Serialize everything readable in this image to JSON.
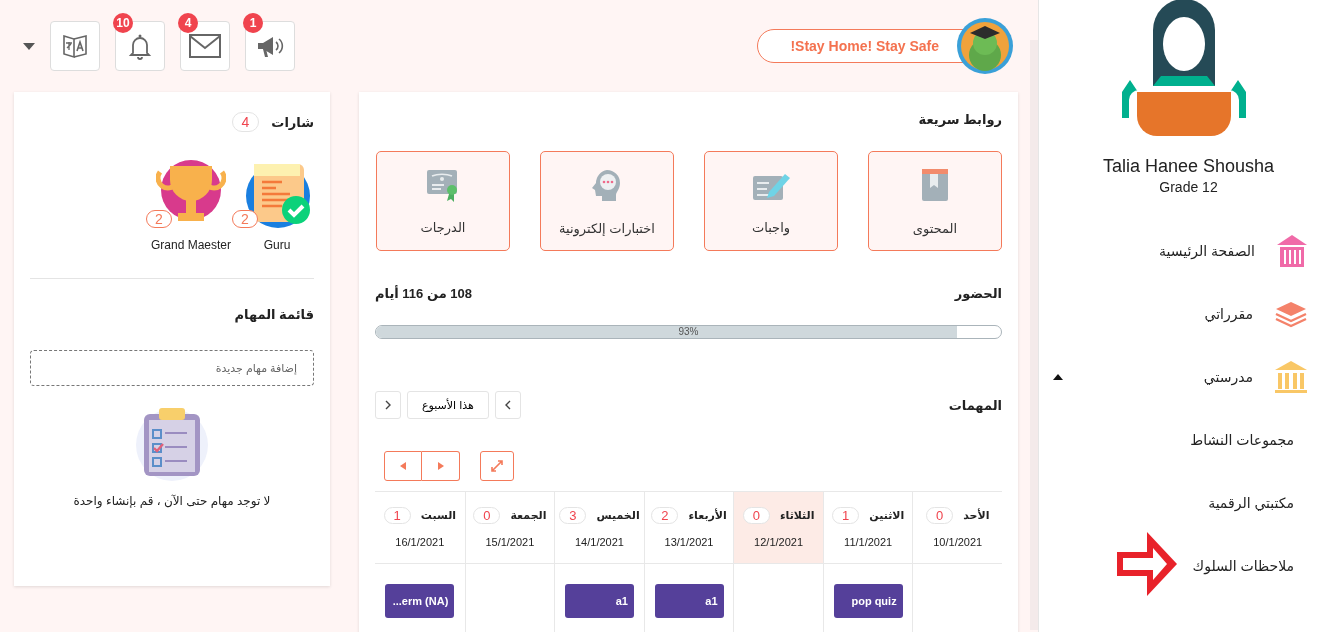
{
  "header": {
    "alerts": [
      {
        "kind": "megaphone",
        "count": "1"
      },
      {
        "kind": "mail",
        "count": "4"
      },
      {
        "kind": "bell",
        "count": "10"
      }
    ],
    "banner": "!Stay Home! Stay Safe"
  },
  "badges": {
    "title": "شارات",
    "count": "4",
    "items": [
      {
        "name": "Guru",
        "count": "2",
        "kind": "scroll"
      },
      {
        "name": "Grand Maester",
        "count": "2",
        "kind": "trophy"
      }
    ]
  },
  "todo": {
    "title": "قائمة المهام",
    "placeholder": "إضافة مهام جديدة",
    "empty_text": "لا توجد مهام حتى الآن ، قم بإنشاء واحدة"
  },
  "quick_links": {
    "title": "روابط سريعة",
    "items": [
      {
        "label": "المحتوى",
        "kind": "book"
      },
      {
        "label": "واجبات",
        "kind": "pen"
      },
      {
        "label": "اختبارات إلكترونية",
        "kind": "head"
      },
      {
        "label": "الدرجات",
        "kind": "certificate"
      }
    ]
  },
  "attendance": {
    "title": "الحضور",
    "summary": "108 من 116 أيام",
    "level": 0.93,
    "reading": "93%"
  },
  "tasks": {
    "title": "المهمات",
    "week_label": "هذا الأسبوع",
    "days": [
      {
        "name": "الأحد",
        "count": "0",
        "date": "10/1/2021",
        "selected": false
      },
      {
        "name": "الاثنين",
        "count": "1",
        "date": "11/1/2021",
        "selected": false,
        "events": [
          "pop quiz"
        ]
      },
      {
        "name": "الثلاثاء",
        "count": "0",
        "date": "12/1/2021",
        "selected": true
      },
      {
        "name": "الأربعاء",
        "count": "2",
        "date": "13/1/2021",
        "selected": false,
        "events": [
          "a1"
        ]
      },
      {
        "name": "الخميس",
        "count": "3",
        "date": "14/1/2021",
        "selected": false,
        "events": [
          "a1"
        ]
      },
      {
        "name": "الجمعة",
        "count": "0",
        "date": "15/1/2021",
        "selected": false
      },
      {
        "name": "السبت",
        "count": "1",
        "date": "16/1/2021",
        "selected": false,
        "events": [
          "...erm (NA)"
        ]
      }
    ]
  },
  "sidebar": {
    "user_name": "Talia Hanee Shousha",
    "grade": "Grade 12",
    "items": [
      {
        "label": "الصفحة الرئيسية",
        "kind": "home"
      },
      {
        "label": "مقرراتي",
        "kind": "courses"
      },
      {
        "label": "مدرستي",
        "kind": "school",
        "expanded": true,
        "children": [
          {
            "label": "مجموعات النشاط",
            "marked": false
          },
          {
            "label": "مكتبتي الرقمية",
            "marked": false
          },
          {
            "label": "ملاحظات السلوك",
            "marked": true
          }
        ]
      }
    ]
  }
}
